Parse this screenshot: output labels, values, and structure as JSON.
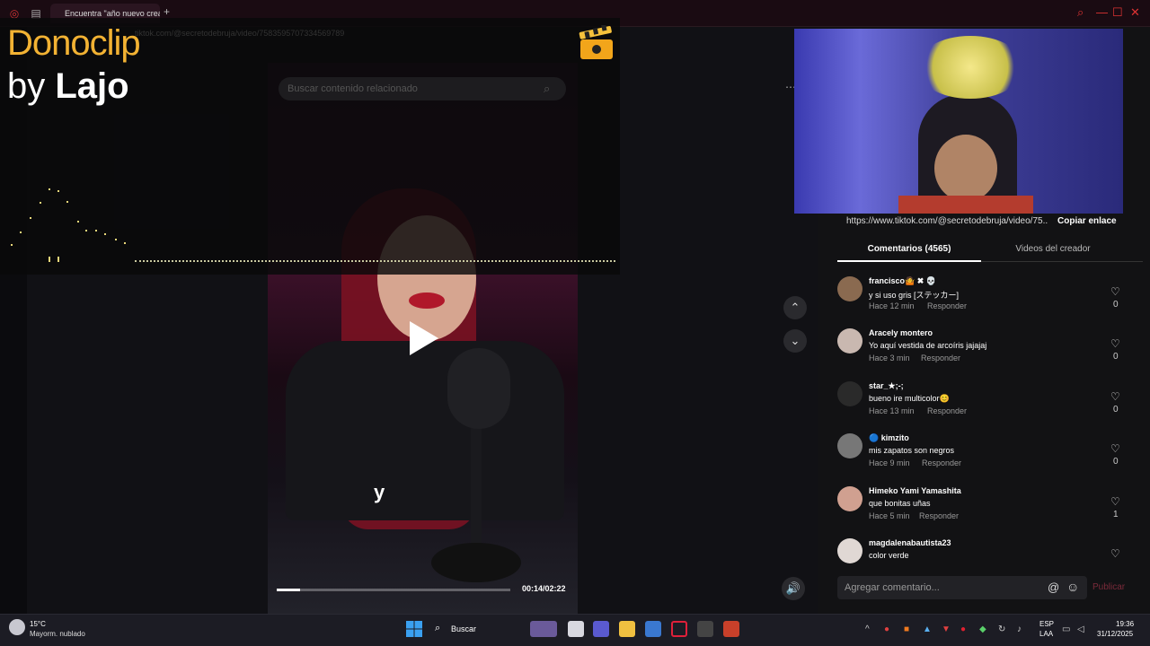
{
  "browser": {
    "tab_title": "Encuentra \"año nuevo crea",
    "new_tab": "+"
  },
  "overlay": {
    "brand_name": "Donoclip",
    "by_word": "by",
    "author_name": "Lajo",
    "url_faded": "tiktok.com/@secretodebruja/video/7583595707334569789",
    "search_placeholder": "Buscar contenido relacionado"
  },
  "video": {
    "caption": "y",
    "timecode": "00:14/02:22",
    "progress": 0.1
  },
  "side": {
    "url": "https://www.tiktok.com/@secretodebruja/video/75...",
    "copy_link": "Copiar enlace",
    "tabs": [
      "Comentarios (4565)",
      "Videos del creador"
    ],
    "comments": [
      {
        "user": "francisco🤷 ✖ 💀",
        "text": "y si uso gris [ステッカー]",
        "time": "Hace 12 min",
        "reply": "Responder",
        "likes": "0"
      },
      {
        "user": "Aracely montero",
        "text": "Yo aquí vestida de arcoíris jajajaj",
        "time": "Hace 3 min",
        "reply": "Responder",
        "likes": "0"
      },
      {
        "user": "star_★;-;",
        "text": "bueno ire multicolor😊",
        "time": "Hace 13 min",
        "reply": "Responder",
        "likes": "0"
      },
      {
        "user": "🔵 kimzito",
        "text": "mis zapatos son negros",
        "time": "Hace 9 min",
        "reply": "Responder",
        "likes": "0"
      },
      {
        "user": "Himeko Yami Yamashita",
        "text": "que bonitas uñas",
        "time": "Hace 5 min",
        "reply": "Responder",
        "likes": "1"
      },
      {
        "user": "magdalenabautista23",
        "text": "color verde",
        "time": "",
        "reply": "",
        "likes": ""
      }
    ],
    "add_comment_placeholder": "Agregar comentario...",
    "publish": "Publicar"
  },
  "taskbar": {
    "temp": "15°C",
    "weather": "Mayorm. nublado",
    "search": "Buscar",
    "lang_line1": "ESP",
    "lang_line2": "LAA",
    "time": "19:36",
    "date": "31/12/2025"
  },
  "colors": {
    "brand": "#f2b233",
    "accent": "#c8102e"
  }
}
